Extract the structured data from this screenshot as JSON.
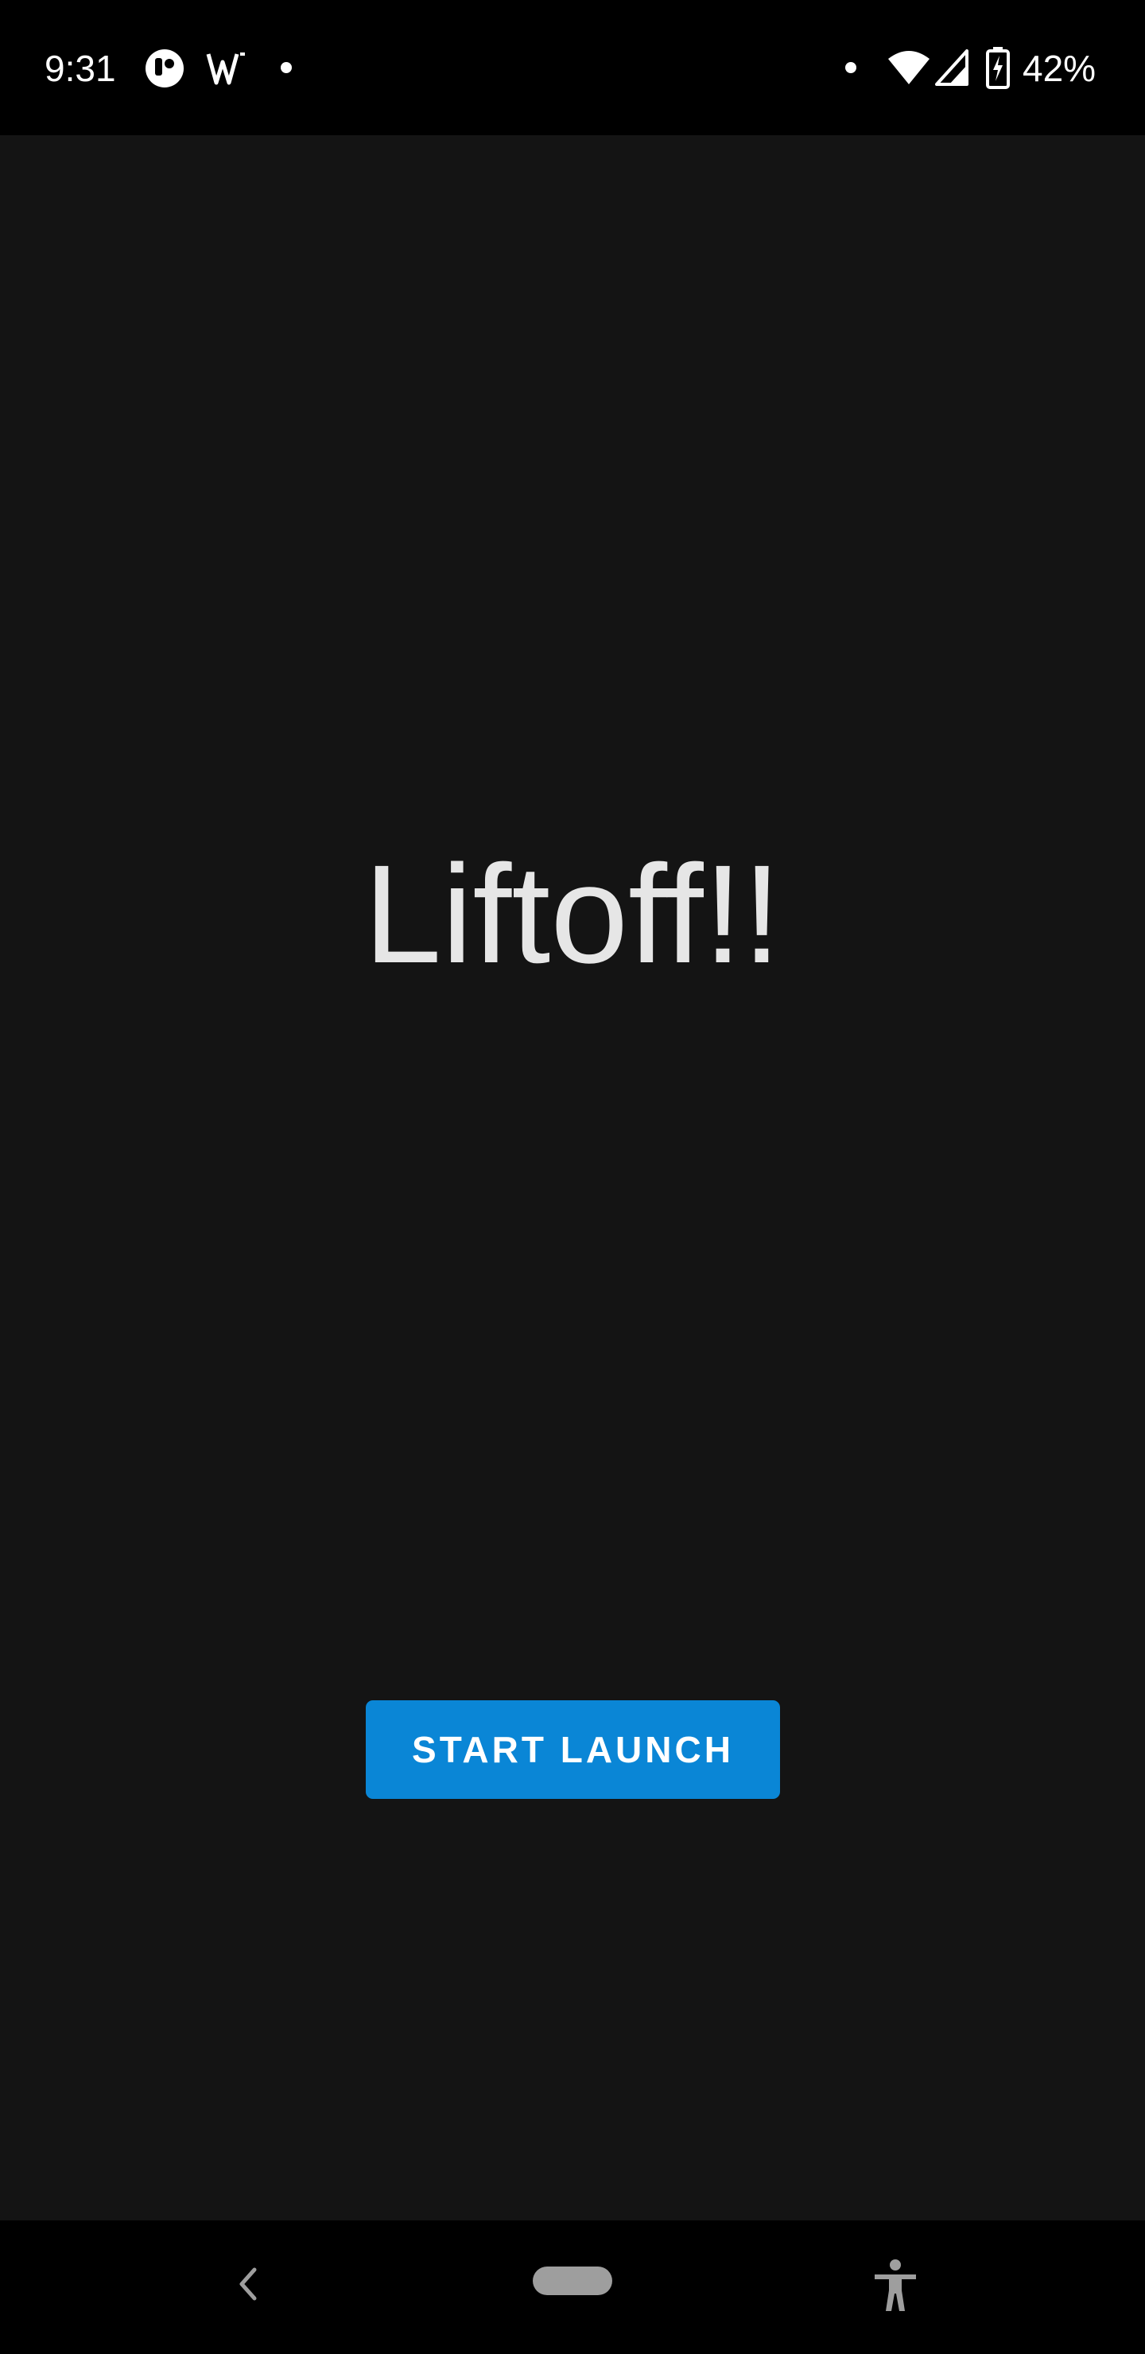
{
  "status_bar": {
    "time": "9:31",
    "battery_percent": "42%",
    "icons": [
      "notification-app-icon",
      "wear-os-icon",
      "dot-icon",
      "dot-icon",
      "wifi-icon",
      "cell-signal-icon",
      "battery-charging-icon"
    ]
  },
  "main": {
    "title": "Liftoff!!",
    "button_label": "START LAUNCH"
  },
  "nav_bar": {
    "icons": [
      "back-icon",
      "home-pill",
      "accessibility-icon"
    ]
  },
  "colors": {
    "background": "#141414",
    "button": "#0a86d6",
    "title_text": "#e6e6e6",
    "bars": "#000000"
  }
}
